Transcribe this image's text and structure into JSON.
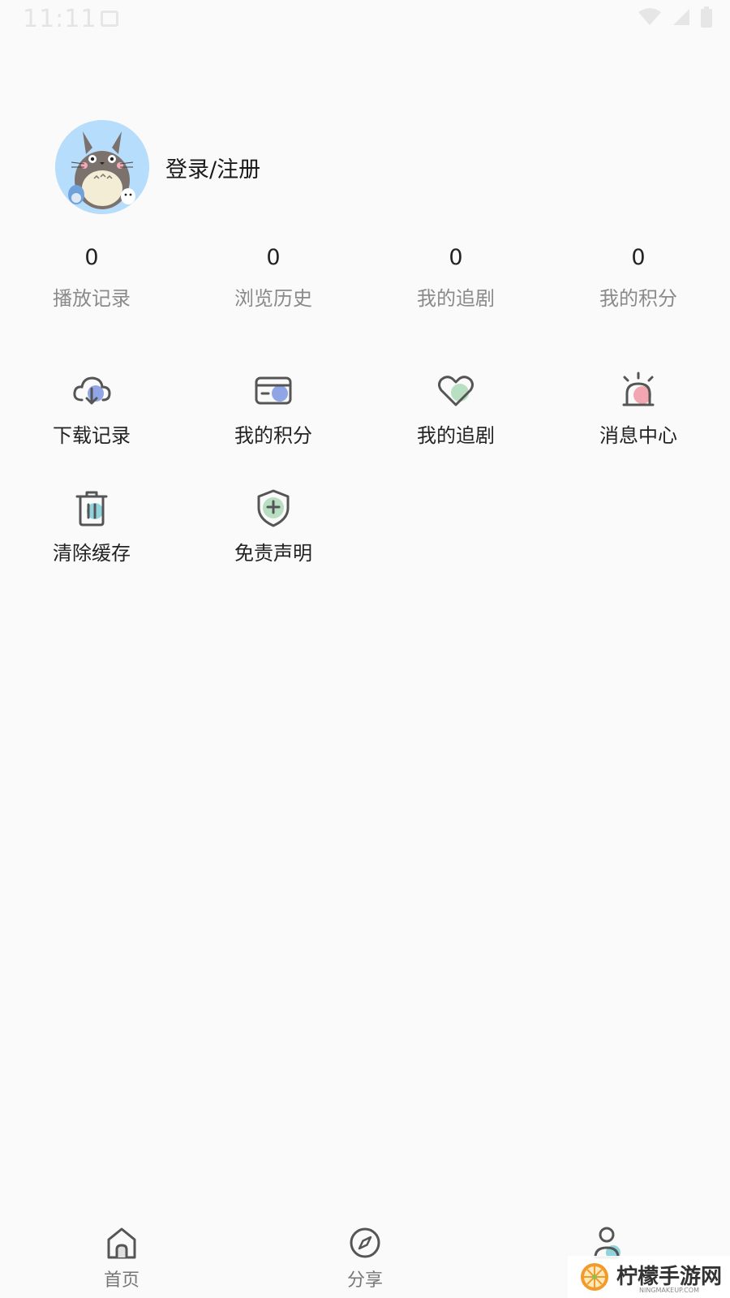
{
  "status_bar": {
    "time": "11:11",
    "icons": [
      "image-icon",
      "wifi-icon",
      "signal-icon",
      "battery-icon"
    ]
  },
  "profile": {
    "avatar_icon": "totoro-avatar",
    "login_label": "登录/注册"
  },
  "stats": [
    {
      "value": "0",
      "label": "播放记录"
    },
    {
      "value": "0",
      "label": "浏览历史"
    },
    {
      "value": "0",
      "label": "我的追剧"
    },
    {
      "value": "0",
      "label": "我的积分"
    }
  ],
  "features": [
    {
      "icon": "cloud-download-icon",
      "label": "下载记录",
      "accent": "#8fa5e6"
    },
    {
      "icon": "card-icon",
      "label": "我的积分",
      "accent": "#8fa5e6"
    },
    {
      "icon": "heart-icon",
      "label": "我的追剧",
      "accent": "#b9dfc2"
    },
    {
      "icon": "alarm-icon",
      "label": "消息中心",
      "accent": "#f2a6b0"
    },
    {
      "icon": "trash-icon",
      "label": "清除缓存",
      "accent": "#8fd3dc"
    },
    {
      "icon": "shield-plus-icon",
      "label": "免责声明",
      "accent": "#b9dfc2"
    }
  ],
  "bottom_nav": [
    {
      "icon": "home-icon",
      "label": "首页"
    },
    {
      "icon": "compass-icon",
      "label": "分享"
    },
    {
      "icon": "user-icon",
      "label": ""
    }
  ],
  "watermark": {
    "text": "柠檬手游网",
    "sub": "NINGMAKEUP.COM"
  },
  "colors": {
    "background": "#fafafa",
    "icon_stroke": "#555555",
    "label_gray": "#8a8a8a"
  }
}
